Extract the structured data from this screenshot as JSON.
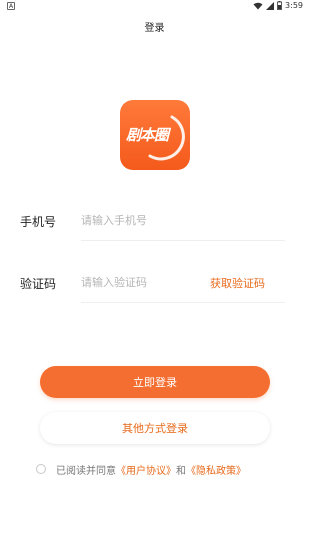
{
  "status_bar": {
    "left_badge": "A",
    "time": "3:59"
  },
  "nav": {
    "title": "登录"
  },
  "logo": {
    "text": "剧本圈",
    "color": "#f36e30"
  },
  "form": {
    "phone": {
      "label": "手机号",
      "placeholder": "请输入手机号"
    },
    "code": {
      "label": "验证码",
      "placeholder": "请输入验证码",
      "get_code_label": "获取验证码"
    }
  },
  "buttons": {
    "login_label": "立即登录",
    "other_login_label": "其他方式登录"
  },
  "agreement": {
    "prefix": "已阅读并同意",
    "user_agreement": "《用户协议》",
    "and": "和",
    "privacy_policy": "《隐私政策》"
  },
  "colors": {
    "accent": "#f36e30",
    "link": "#e76a1c"
  }
}
